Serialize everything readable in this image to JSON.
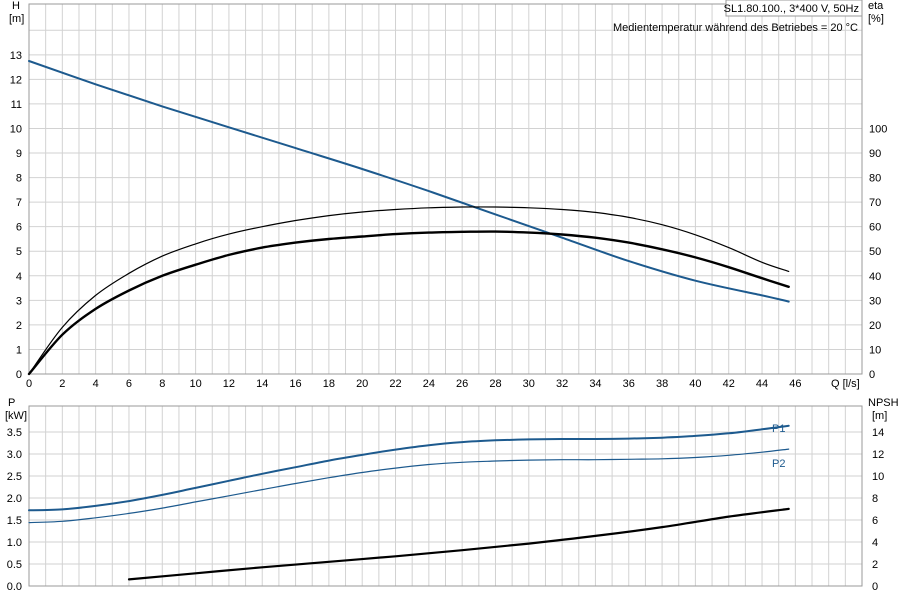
{
  "header": {
    "title": "SL1.80.100., 3*400 V, 50Hz",
    "note": "Medientemperatur während des Betriebes = 20 °C"
  },
  "colors": {
    "blue": "#1d5a8e",
    "black": "#000000",
    "grid": "#d2d2d2"
  },
  "chart_data": [
    {
      "type": "line",
      "xlabel": "Q [l/s]",
      "ylabel": "H [m]",
      "ylabel_parts": [
        "H",
        "[m]"
      ],
      "y2label_parts": [
        "eta",
        "[%]"
      ],
      "grid": true,
      "xlim": [
        0,
        50
      ],
      "ylim": [
        0,
        15.07
      ],
      "y2lim": [
        0,
        150.7
      ],
      "x_ticks": [
        0,
        2,
        4,
        6,
        8,
        10,
        12,
        14,
        16,
        18,
        20,
        22,
        24,
        26,
        28,
        30,
        32,
        34,
        36,
        38,
        40,
        42,
        44,
        46
      ],
      "y_ticks": [
        0,
        1,
        2,
        3,
        4,
        5,
        6,
        7,
        8,
        9,
        10,
        11,
        12,
        13
      ],
      "y2_ticks": [
        0,
        10,
        20,
        30,
        40,
        50,
        60,
        70,
        80,
        90,
        100
      ],
      "series": [
        {
          "axis": "left",
          "color": "#1d5a8e",
          "width": 2,
          "x": [
            0,
            4,
            8,
            12,
            16,
            20,
            24,
            28,
            32,
            36,
            40,
            44,
            45.6
          ],
          "y": [
            12.75,
            11.8,
            10.9,
            10.05,
            9.2,
            8.35,
            7.45,
            6.5,
            5.55,
            4.6,
            3.8,
            3.2,
            2.95
          ]
        },
        {
          "axis": "right",
          "color": "#000000",
          "width": 1.2,
          "x": [
            0,
            2,
            4,
            6,
            8,
            10,
            12,
            14,
            16,
            18,
            20,
            22,
            24,
            26,
            28,
            30,
            32,
            34,
            36,
            38,
            40,
            42,
            44,
            45.6
          ],
          "y": [
            0,
            19,
            32,
            41,
            48,
            53,
            57,
            60,
            62.5,
            64.5,
            66,
            67,
            67.7,
            68,
            68,
            67.7,
            67,
            65.8,
            63.8,
            60.8,
            56.7,
            51.5,
            45.5,
            41.8
          ]
        },
        {
          "axis": "right",
          "color": "#000000",
          "width": 2.4,
          "x": [
            0,
            2,
            4,
            6,
            8,
            10,
            12,
            14,
            16,
            18,
            20,
            22,
            24,
            26,
            28,
            30,
            32,
            34,
            36,
            38,
            40,
            42,
            44,
            45.6
          ],
          "y": [
            0,
            16,
            26.5,
            34,
            40,
            44.5,
            48.5,
            51.5,
            53.5,
            55,
            56,
            57,
            57.6,
            57.9,
            58,
            57.6,
            56.8,
            55.5,
            53.5,
            50.8,
            47.5,
            43.5,
            39,
            35.5
          ]
        }
      ]
    },
    {
      "type": "line",
      "xlabel": "",
      "ylabel": "P [kW]",
      "ylabel_parts": [
        "P",
        "[kW]"
      ],
      "y2label_parts": [
        "NPSH",
        "[m]"
      ],
      "grid": true,
      "xlim": [
        0,
        50
      ],
      "ylim": [
        0,
        4.09
      ],
      "y2lim": [
        0,
        16.35
      ],
      "y_ticks": [
        "0.0",
        "0.5",
        "1.0",
        "1.5",
        "2.0",
        "2.5",
        "3.0",
        "3.5"
      ],
      "y2_ticks": [
        0,
        2,
        4,
        6,
        8,
        10,
        12,
        14
      ],
      "series": [
        {
          "name": "P1",
          "axis": "left",
          "color": "#1d5a8e",
          "width": 2,
          "x": [
            0,
            2,
            4,
            6,
            8,
            10,
            12,
            14,
            16,
            18,
            20,
            22,
            24,
            26,
            28,
            30,
            32,
            34,
            36,
            38,
            40,
            42,
            44,
            45.6
          ],
          "y": [
            1.72,
            1.74,
            1.82,
            1.93,
            2.07,
            2.23,
            2.39,
            2.55,
            2.7,
            2.85,
            2.98,
            3.1,
            3.2,
            3.27,
            3.31,
            3.33,
            3.34,
            3.34,
            3.35,
            3.37,
            3.41,
            3.47,
            3.56,
            3.64
          ]
        },
        {
          "name": "P2",
          "axis": "left",
          "color": "#1d5a8e",
          "width": 1.2,
          "x": [
            0,
            2,
            4,
            6,
            8,
            10,
            12,
            14,
            16,
            18,
            20,
            22,
            24,
            26,
            28,
            30,
            32,
            34,
            36,
            38,
            40,
            42,
            44,
            45.6
          ],
          "y": [
            1.44,
            1.47,
            1.55,
            1.65,
            1.77,
            1.91,
            2.05,
            2.19,
            2.33,
            2.46,
            2.58,
            2.68,
            2.76,
            2.81,
            2.84,
            2.86,
            2.87,
            2.87,
            2.88,
            2.89,
            2.92,
            2.97,
            3.04,
            3.11
          ]
        },
        {
          "axis": "right",
          "color": "#000000",
          "width": 2.2,
          "x": [
            6,
            10,
            14,
            18,
            22,
            26,
            30,
            34,
            38,
            42,
            45.6
          ],
          "y": [
            0.6,
            1.15,
            1.7,
            2.2,
            2.7,
            3.25,
            3.85,
            4.55,
            5.35,
            6.3,
            7.0
          ]
        }
      ]
    }
  ]
}
